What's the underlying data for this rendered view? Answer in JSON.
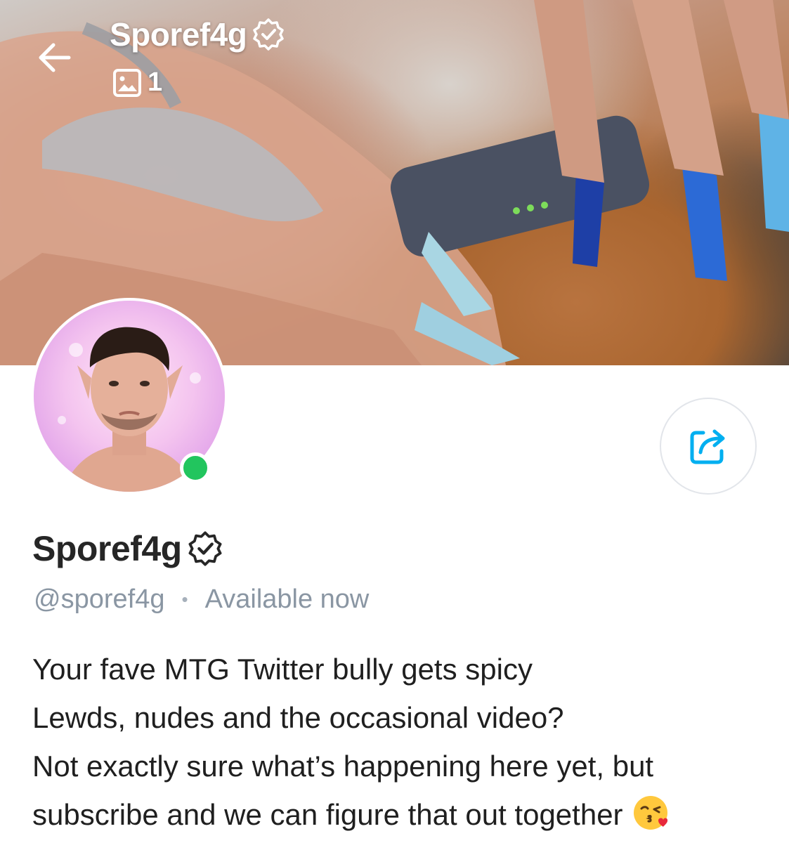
{
  "header": {
    "back_icon": "arrow-left-icon",
    "title": "Sporef4g",
    "verified_icon": "verified-badge-icon",
    "media_icon": "image-icon",
    "media_count": "1"
  },
  "profile": {
    "name": "Sporef4g",
    "verified_icon": "verified-badge-icon",
    "handle": "@sporef4g",
    "separator": "•",
    "status": "Available now",
    "online_status_color": "#22c55e",
    "share_icon": "share-icon"
  },
  "bio": {
    "lines": [
      "Your fave MTG Twitter bully gets spicy",
      "Lewds, nudes and the occasional video?",
      "Not exactly sure what’s happening here yet, but",
      "subscribe and we can figure that out together"
    ],
    "trailing_emoji": "kissing-face-emoji"
  },
  "colors": {
    "accent": "#00aff0",
    "text_primary": "#262626",
    "text_secondary": "#8a96a3",
    "online": "#22c55e"
  }
}
